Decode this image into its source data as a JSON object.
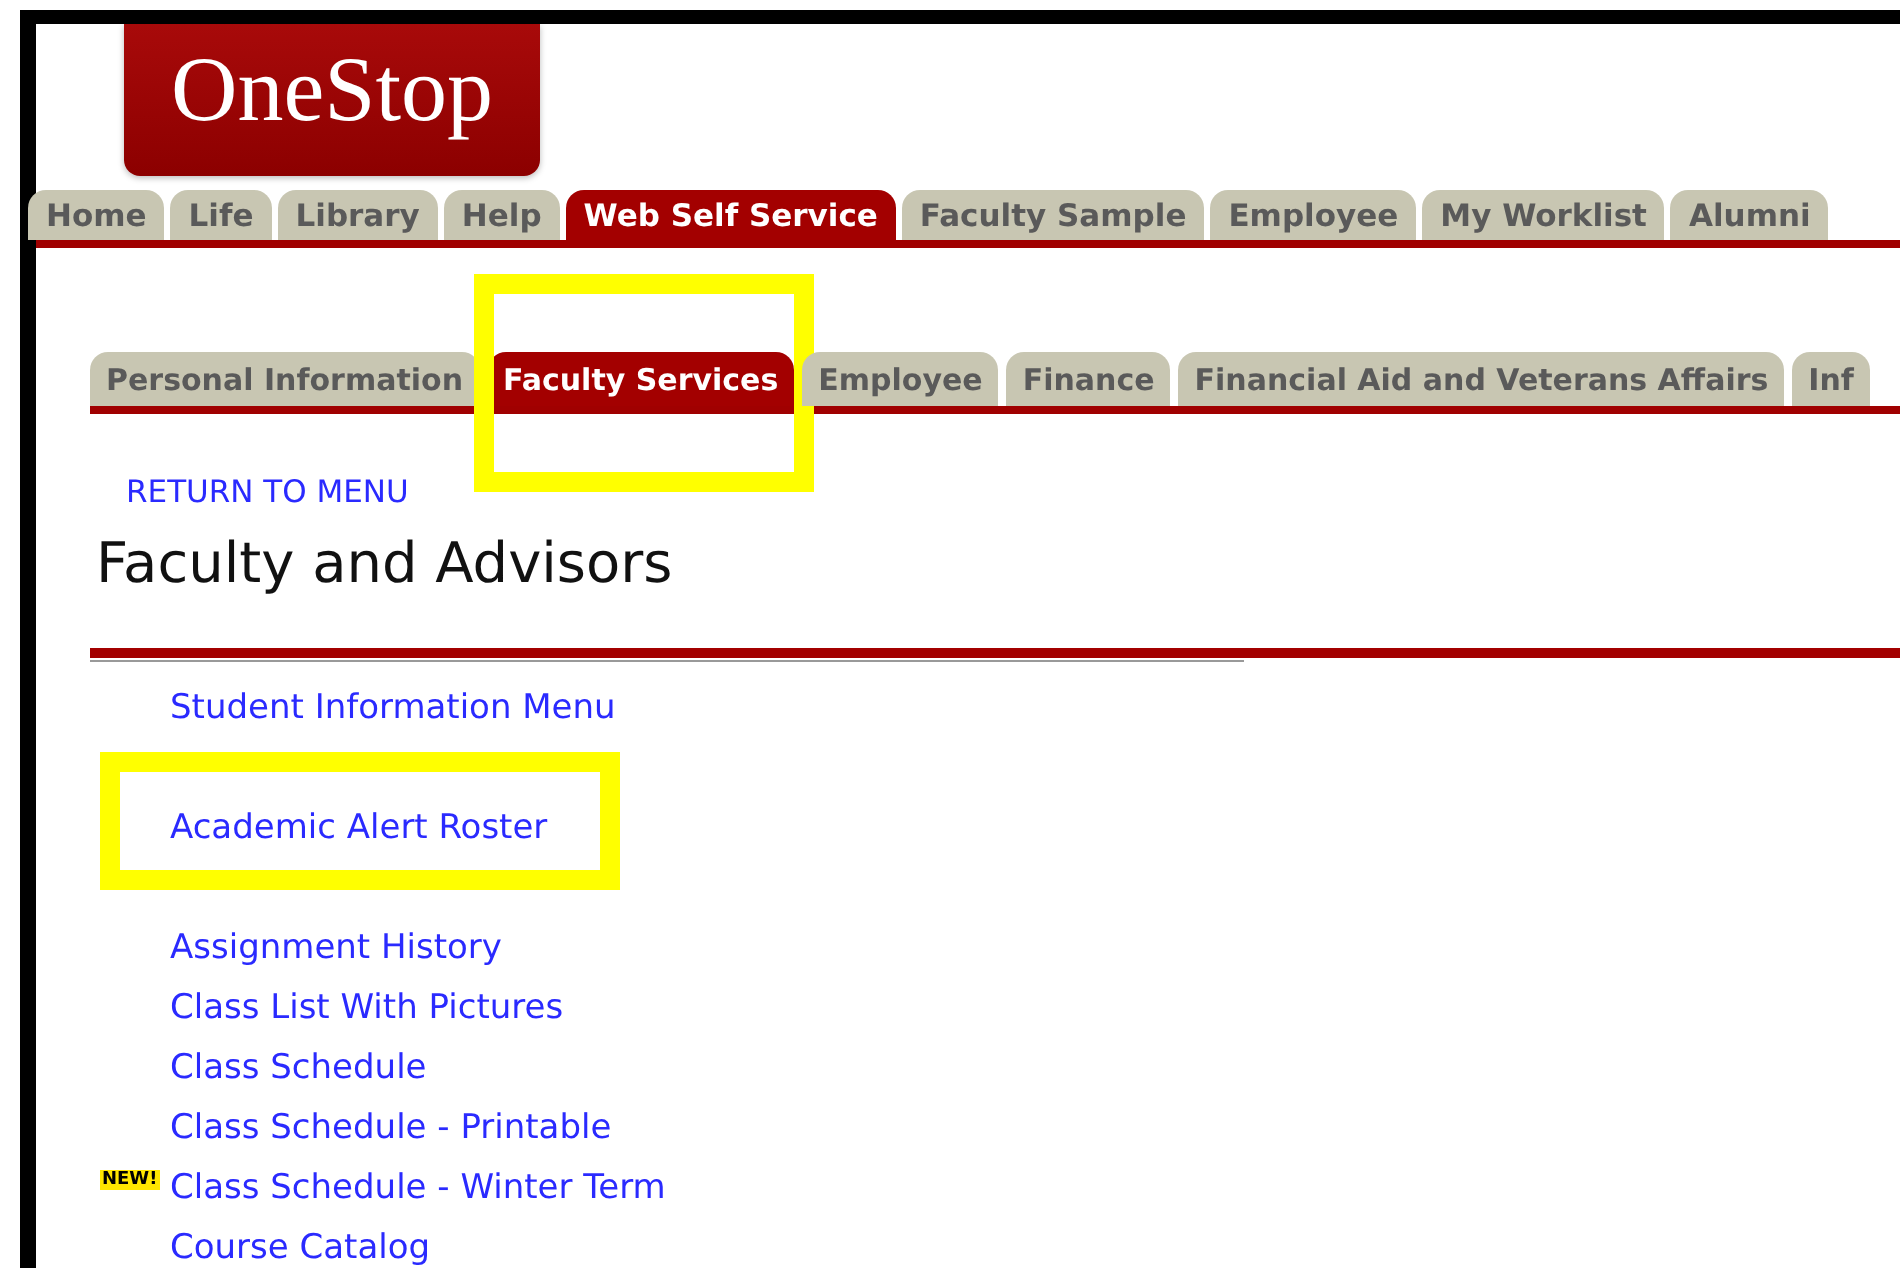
{
  "logo": {
    "text": "OneStop"
  },
  "main_tabs": [
    {
      "label": "Home",
      "selected": false
    },
    {
      "label": "Life",
      "selected": false
    },
    {
      "label": "Library",
      "selected": false
    },
    {
      "label": "Help",
      "selected": false
    },
    {
      "label": "Web Self Service",
      "selected": true
    },
    {
      "label": "Faculty Sample",
      "selected": false
    },
    {
      "label": "Employee",
      "selected": false
    },
    {
      "label": "My Worklist",
      "selected": false
    },
    {
      "label": "Alumni",
      "selected": false
    }
  ],
  "sub_tabs": [
    {
      "label": "Personal Information",
      "selected": false,
      "highlighted": false
    },
    {
      "label": "Faculty Services",
      "selected": true,
      "highlighted": true
    },
    {
      "label": "Employee",
      "selected": false,
      "highlighted": false
    },
    {
      "label": "Finance",
      "selected": false,
      "highlighted": false
    },
    {
      "label": "Financial Aid and Veterans Affairs",
      "selected": false,
      "highlighted": false
    },
    {
      "label": "Inf",
      "selected": false,
      "highlighted": false
    }
  ],
  "nav_links": [
    "RETURN TO MENU"
  ],
  "heading": "Faculty and Advisors",
  "menu_items": [
    {
      "label": "Student Information Menu",
      "highlighted": false
    },
    {
      "label": "Academic Alert Roster",
      "highlighted": true
    },
    {
      "label": "Assignment History",
      "highlighted": false
    },
    {
      "label": "Class List With Pictures",
      "highlighted": false
    },
    {
      "label": "Class Schedule",
      "highlighted": false
    },
    {
      "label": "Class Schedule - Printable",
      "highlighted": false
    },
    {
      "label": "Class Schedule - Winter Term",
      "highlighted": false,
      "badge": "NEW!"
    },
    {
      "label": "Course Catalog",
      "highlighted": false
    }
  ]
}
